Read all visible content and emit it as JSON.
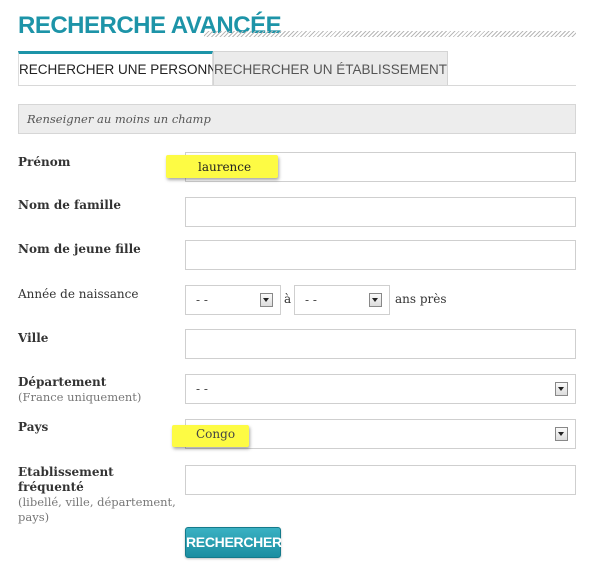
{
  "header": {
    "title": "RECHERCHE AVANCÉE"
  },
  "tabs": [
    {
      "label": "RECHERCHER UNE PERSONNE",
      "active": true
    },
    {
      "label": "RECHERCHER UN ÉTABLISSEMENT",
      "active": false
    }
  ],
  "form": {
    "hint": "Renseigner au moins un champ",
    "prenom": {
      "label": "Prénom",
      "value": "laurence"
    },
    "nom_famille": {
      "label": "Nom de famille",
      "value": ""
    },
    "nom_jeune_fille": {
      "label": "Nom de jeune fille",
      "value": ""
    },
    "annee_naissance": {
      "label": "Année de naissance",
      "from_value": "- -",
      "separator": "à",
      "to_value": "- -",
      "suffix": "ans près"
    },
    "ville": {
      "label": "Ville",
      "value": ""
    },
    "departement": {
      "label": "Département",
      "sublabel": "(France uniquement)",
      "value": "- -"
    },
    "pays": {
      "label": "Pays",
      "value": "Congo"
    },
    "etablissement": {
      "label": "Etablissement fréquenté",
      "sublabel": "(libellé, ville, département, pays)",
      "value": ""
    },
    "submit_label": "RECHERCHER"
  },
  "colors": {
    "accent": "#1d94a8",
    "highlight": "#fdfb44"
  }
}
